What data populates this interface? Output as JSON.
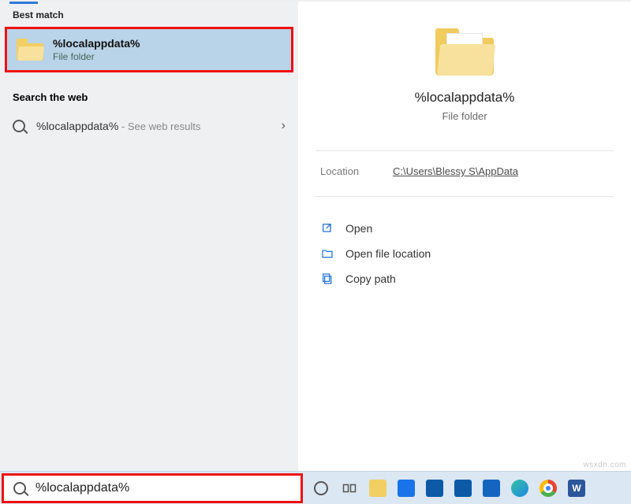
{
  "left": {
    "best_match_header": "Best match",
    "best_match": {
      "title": "%localappdata%",
      "subtitle": "File folder"
    },
    "web_header": "Search the web",
    "web_item": {
      "label": "%localappdata%",
      "suffix": " - See web results"
    }
  },
  "right": {
    "title": "%localappdata%",
    "subtitle": "File folder",
    "location_label": "Location",
    "location_value": "C:\\Users\\Blessy S\\AppData",
    "actions": {
      "open": "Open",
      "open_location": "Open file location",
      "copy_path": "Copy path"
    }
  },
  "search": {
    "value": "%localappdata%"
  },
  "watermark": "wsxdn.com"
}
